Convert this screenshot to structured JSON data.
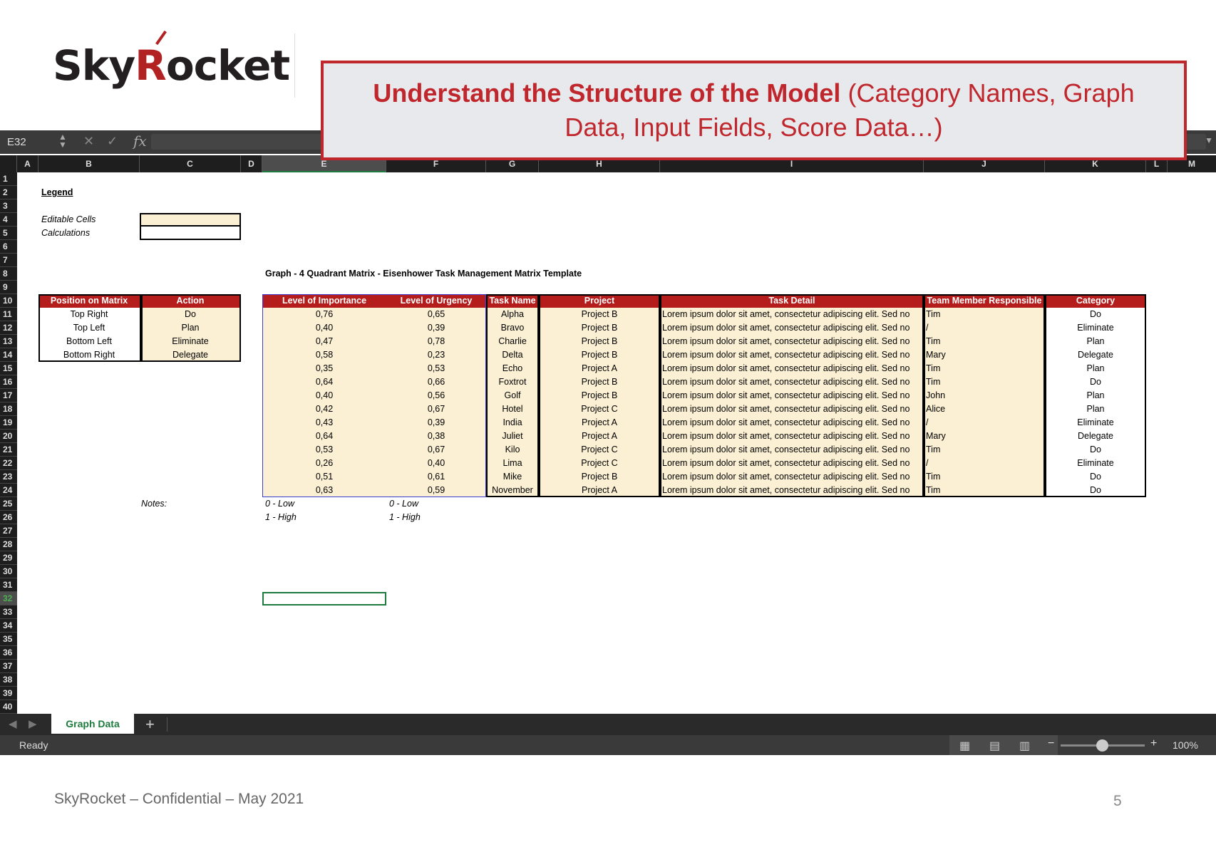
{
  "logo": {
    "text_a": "Sky",
    "text_r": "R",
    "text_b": "ocket"
  },
  "callout": {
    "bold": "Understand the Structure of the Model",
    "rest": "(Category Names, Graph Data, Input Fields, Score Data…)"
  },
  "formula_bar": {
    "cell_ref": "E32",
    "fx": "fx",
    "value": ""
  },
  "columns": [
    "A",
    "B",
    "C",
    "D",
    "E",
    "F",
    "G",
    "H",
    "I",
    "J",
    "K",
    "L",
    "M"
  ],
  "rows": [
    "1",
    "2",
    "3",
    "4",
    "5",
    "6",
    "7",
    "8",
    "9",
    "10",
    "11",
    "12",
    "13",
    "14",
    "15",
    "16",
    "17",
    "18",
    "19",
    "20",
    "21",
    "22",
    "23",
    "24",
    "25",
    "26",
    "27",
    "28",
    "29",
    "30",
    "31",
    "32",
    "33",
    "34",
    "35",
    "36",
    "37",
    "38",
    "39",
    "40"
  ],
  "selected_row": "32",
  "legend": {
    "title": "Legend",
    "editable": "Editable Cells",
    "calculations": "Calculations"
  },
  "graph_title": "Graph - 4 Quadrant Matrix  - Eisenhower Task Management Matrix Template",
  "matrix_table": {
    "headers": [
      "Position on Matrix",
      "Action"
    ],
    "rows": [
      [
        "Top Right",
        "Do"
      ],
      [
        "Top Left",
        "Plan"
      ],
      [
        "Bottom Left",
        "Eliminate"
      ],
      [
        "Bottom Right",
        "Delegate"
      ]
    ]
  },
  "task_table": {
    "headers": [
      "Level of Importance",
      "Level of Urgency",
      "Task Name",
      "Project",
      "Task Detail",
      "Team Member Responsible",
      "Category"
    ],
    "rows": [
      [
        "0,76",
        "0,65",
        "Alpha",
        "Project B",
        "Lorem ipsum dolor sit amet, consectetur adipiscing elit. Sed no",
        "Tim",
        "Do"
      ],
      [
        "0,40",
        "0,39",
        "Bravo",
        "Project B",
        "Lorem ipsum dolor sit amet, consectetur adipiscing elit. Sed no",
        "/",
        "Eliminate"
      ],
      [
        "0,47",
        "0,78",
        "Charlie",
        "Project B",
        "Lorem ipsum dolor sit amet, consectetur adipiscing elit. Sed no",
        "Tim",
        "Plan"
      ],
      [
        "0,58",
        "0,23",
        "Delta",
        "Project B",
        "Lorem ipsum dolor sit amet, consectetur adipiscing elit. Sed no",
        "Mary",
        "Delegate"
      ],
      [
        "0,35",
        "0,53",
        "Echo",
        "Project A",
        "Lorem ipsum dolor sit amet, consectetur adipiscing elit. Sed no",
        "Tim",
        "Plan"
      ],
      [
        "0,64",
        "0,66",
        "Foxtrot",
        "Project B",
        "Lorem ipsum dolor sit amet, consectetur adipiscing elit. Sed no",
        "Tim",
        "Do"
      ],
      [
        "0,40",
        "0,56",
        "Golf",
        "Project B",
        "Lorem ipsum dolor sit amet, consectetur adipiscing elit. Sed no",
        "John",
        "Plan"
      ],
      [
        "0,42",
        "0,67",
        "Hotel",
        "Project C",
        "Lorem ipsum dolor sit amet, consectetur adipiscing elit. Sed no",
        "Alice",
        "Plan"
      ],
      [
        "0,43",
        "0,39",
        "India",
        "Project A",
        "Lorem ipsum dolor sit amet, consectetur adipiscing elit. Sed no",
        "/",
        "Eliminate"
      ],
      [
        "0,64",
        "0,38",
        "Juliet",
        "Project A",
        "Lorem ipsum dolor sit amet, consectetur adipiscing elit. Sed no",
        "Mary",
        "Delegate"
      ],
      [
        "0,53",
        "0,67",
        "Kilo",
        "Project C",
        "Lorem ipsum dolor sit amet, consectetur adipiscing elit. Sed no",
        "Tim",
        "Do"
      ],
      [
        "0,26",
        "0,40",
        "Lima",
        "Project C",
        "Lorem ipsum dolor sit amet, consectetur adipiscing elit. Sed no",
        "/",
        "Eliminate"
      ],
      [
        "0,51",
        "0,61",
        "Mike",
        "Project B",
        "Lorem ipsum dolor sit amet, consectetur adipiscing elit. Sed no",
        "Tim",
        "Do"
      ],
      [
        "0,63",
        "0,59",
        "November",
        "Project A",
        "Lorem ipsum dolor sit amet, consectetur adipiscing elit. Sed no",
        "Tim",
        "Do"
      ]
    ]
  },
  "notes": {
    "label": "Notes:",
    "imp_low": "0 - Low",
    "imp_high": "1 - High",
    "urg_low": "0 - Low",
    "urg_high": "1 - High"
  },
  "sheet_tabs": {
    "active": "Graph Data",
    "add": "+"
  },
  "status": {
    "text": "Ready",
    "zoom": "100%"
  },
  "footer": {
    "text": "SkyRocket – Confidential – May 2021",
    "page": "5"
  },
  "colors": {
    "header_red": "#b51c1c",
    "editable": "#fbf0d4",
    "callout_border": "#c0272d",
    "tab_green": "#1e7b3e"
  }
}
